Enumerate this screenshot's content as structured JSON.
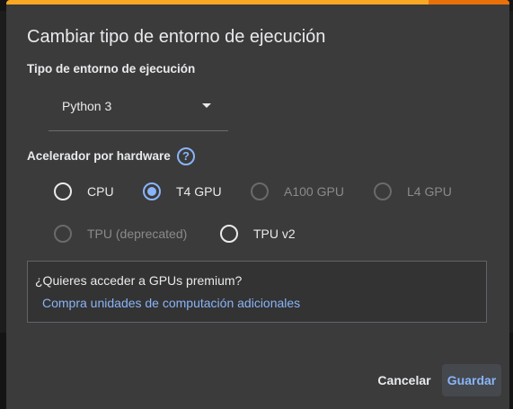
{
  "dialog": {
    "title": "Cambiar tipo de entorno de ejecución",
    "runtime_section_label": "Tipo de entorno de ejecución",
    "runtime_select": {
      "value": "Python 3",
      "caret_icon": "caret-down-icon"
    },
    "hardware_section_label": "Acelerador por hardware",
    "help_icon": {
      "name": "help-icon",
      "glyph": "?"
    },
    "accelerators": [
      {
        "label": "CPU",
        "checked": false,
        "disabled": false
      },
      {
        "label": "T4 GPU",
        "checked": true,
        "disabled": false
      },
      {
        "label": "A100 GPU",
        "checked": false,
        "disabled": true
      },
      {
        "label": "L4 GPU",
        "checked": false,
        "disabled": true
      },
      {
        "label": "TPU (deprecated)",
        "checked": false,
        "disabled": true
      },
      {
        "label": "TPU v2",
        "checked": false,
        "disabled": false
      }
    ],
    "promo": {
      "title": "¿Quieres acceder a GPUs premium?",
      "link": "Compra unidades de computación adicionales"
    },
    "buttons": {
      "cancel": "Cancelar",
      "save": "Guardar"
    }
  },
  "colors": {
    "dialog_bg": "#3b3b3b",
    "accent": "#8ab4f8",
    "progress": "#f9a825",
    "progress_tail": "#e8710a"
  }
}
